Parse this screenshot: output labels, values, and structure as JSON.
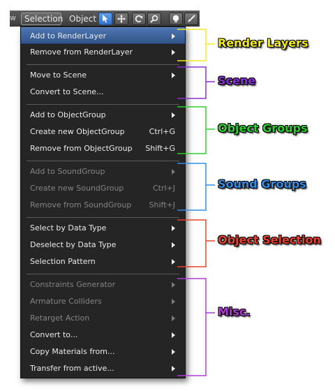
{
  "header": {
    "left_fragment": "w",
    "menus": {
      "selection": "Selection",
      "object": "Object"
    },
    "tools": [
      "select-icon",
      "translate-icon",
      "rotate-icon",
      "scale-icon",
      "light-icon",
      "paint-brush-icon"
    ]
  },
  "menu": {
    "items": [
      {
        "label": "Add to RenderLayer",
        "submenu": true,
        "disabled": false,
        "hover": true
      },
      {
        "label": "Remove from RenderLayer",
        "submenu": true,
        "disabled": false
      },
      {
        "label": "Move to Scene",
        "submenu": true,
        "disabled": false
      },
      {
        "label": "Convert to Scene...",
        "submenu": false,
        "disabled": false
      },
      {
        "label": "Add to ObjectGroup",
        "submenu": true,
        "disabled": false
      },
      {
        "label": "Create new ObjectGroup",
        "shortcut": "Ctrl+G",
        "disabled": false
      },
      {
        "label": "Remove from ObjectGroup",
        "shortcut": "Shift+G",
        "disabled": false
      },
      {
        "label": "Add to SoundGroup",
        "submenu": true,
        "disabled": true
      },
      {
        "label": "Create new SoundGroup",
        "shortcut": "Ctrl+J",
        "disabled": true
      },
      {
        "label": "Remove from SoundGroup",
        "shortcut": "Shift+J",
        "disabled": true
      },
      {
        "label": "Select by Data Type",
        "submenu": true,
        "disabled": false
      },
      {
        "label": "Deselect by Data Type",
        "submenu": true,
        "disabled": false
      },
      {
        "label": "Selection Pattern",
        "submenu": true,
        "disabled": false
      },
      {
        "label": "Constraints Generator",
        "submenu": true,
        "disabled": true
      },
      {
        "label": "Armature Colliders",
        "submenu": true,
        "disabled": true
      },
      {
        "label": "Retarget Action",
        "submenu": true,
        "disabled": true
      },
      {
        "label": "Convert to...",
        "submenu": true,
        "disabled": false
      },
      {
        "label": "Copy Materials from...",
        "submenu": true,
        "disabled": false
      },
      {
        "label": "Transfer from active...",
        "submenu": true,
        "disabled": false
      }
    ]
  },
  "annotations": [
    {
      "label": "Render Layers",
      "color": "#f2ec1f"
    },
    {
      "label": "Scene",
      "color": "#8a2fd4"
    },
    {
      "label": "Object Groups",
      "color": "#2ad12a"
    },
    {
      "label": "Sound Groups",
      "color": "#2f8fe8"
    },
    {
      "label": "Object Selection",
      "color": "#e8402a"
    },
    {
      "label": "Misc.",
      "color": "#b03ad6"
    }
  ],
  "colors": {
    "menu_bg": "#252525",
    "hover": "#3e64a0",
    "text": "#e9e9e9",
    "disabled_text": "#848484"
  }
}
